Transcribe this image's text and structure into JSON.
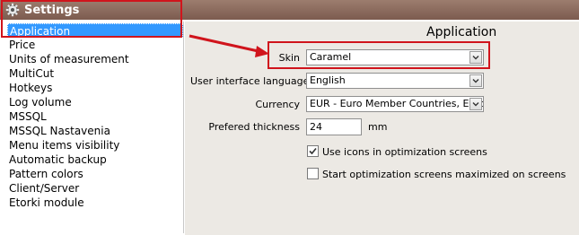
{
  "window": {
    "title": "Settings"
  },
  "nav": {
    "items": [
      {
        "label": "Application",
        "selected": true
      },
      {
        "label": "Price"
      },
      {
        "label": "Units of measurement"
      },
      {
        "label": "MultiCut"
      },
      {
        "label": "Hotkeys"
      },
      {
        "label": "Log volume"
      },
      {
        "label": "MSSQL"
      },
      {
        "label": "MSSQL Nastavenia"
      },
      {
        "label": "Menu items visibility"
      },
      {
        "label": "Automatic backup"
      },
      {
        "label": "Pattern colors"
      },
      {
        "label": "Client/Server"
      },
      {
        "label": "Etorki module"
      }
    ]
  },
  "section": {
    "title": "Application"
  },
  "form": {
    "skin": {
      "label": "Skin",
      "value": "Caramel"
    },
    "language": {
      "label": "User interface language",
      "value": "English"
    },
    "currency": {
      "label": "Currency",
      "value": "EUR - Euro Member Countries, Euro"
    },
    "thickness": {
      "label": "Prefered thickness",
      "value": "24",
      "unit": "mm"
    },
    "use_icons": {
      "label": "Use icons in optimization screens",
      "checked": true
    },
    "start_maximized": {
      "label": "Start optimization screens maximized on screens",
      "checked": false
    }
  },
  "colors": {
    "highlight": "#d0141c",
    "selection": "#3399ff",
    "titlebar": "#8a6a5d"
  }
}
